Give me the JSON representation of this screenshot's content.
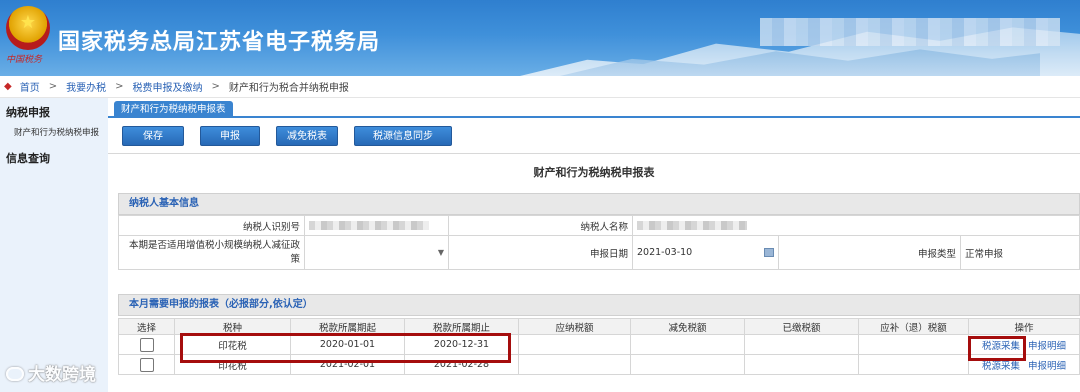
{
  "header": {
    "title": "国家税务总局江苏省电子税务局",
    "motto": "中国税务"
  },
  "breadcrumb": {
    "items": [
      "首页",
      "我要办税",
      "税费申报及缴纳",
      "财产和行为税合并纳税申报"
    ],
    "separator": ">"
  },
  "sidebar": {
    "section1": "纳税申报",
    "section1_item": "财产和行为税纳税申报",
    "section2": "信息查询"
  },
  "tab": {
    "label": "财产和行为税纳税申报表"
  },
  "toolbar": {
    "save": "保存",
    "declare": "申报",
    "reduce": "减免税表",
    "sync": "税源信息同步"
  },
  "form_title": "财产和行为税纳税申报表",
  "basic_info": {
    "heading": "纳税人基本信息",
    "taxpayer_id_label": "纳税人识别号",
    "taxpayer_name_label": "纳税人名称",
    "policy_label": "本期是否适用增值税小规模纳税人减征政策",
    "declare_date_label": "申报日期",
    "declare_date": "2021-03-10",
    "declare_type_label": "申报类型",
    "declare_type": "正常申报"
  },
  "reports": {
    "heading": "本月需要申报的报表（必报部分,依认定）",
    "columns": [
      "选择",
      "税种",
      "税款所属期起",
      "税款所属期止",
      "应纳税额",
      "减免税额",
      "已缴税额",
      "应补（退）税额",
      "操作"
    ],
    "rows": [
      {
        "tax": "印花税",
        "start": "2020-01-01",
        "end": "2020-12-31",
        "action1": "税源采集",
        "action2": "申报明细"
      },
      {
        "tax": "印花税",
        "start": "2021-02-01",
        "end": "2021-02-28",
        "action1": "税源采集",
        "action2": "申报明细"
      }
    ]
  },
  "watermark": "大数跨境",
  "colors": {
    "accent": "#3a84d0",
    "highlight": "#a50d0d",
    "link": "#2a62b5"
  }
}
